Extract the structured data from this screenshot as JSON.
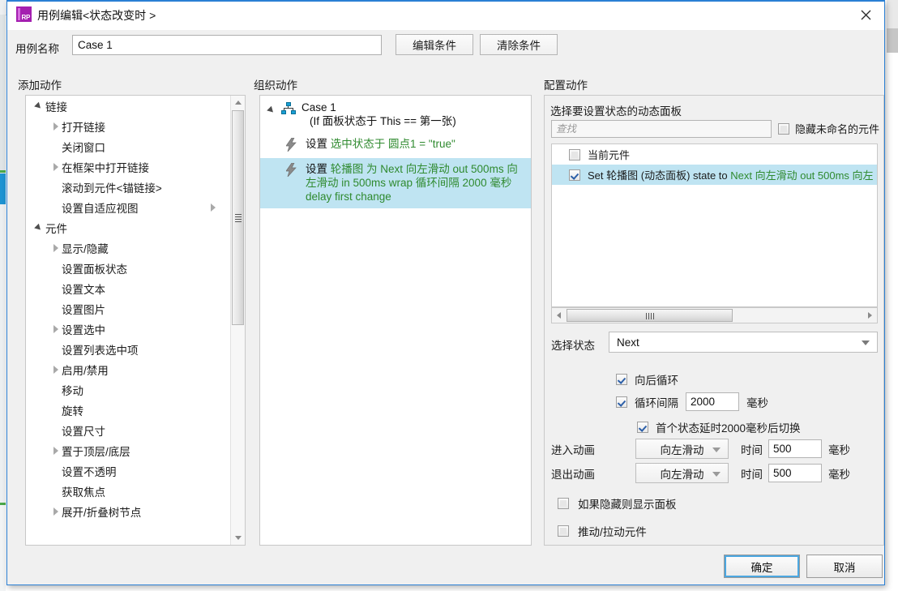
{
  "window": {
    "title": "用例编辑<状态改变时 >",
    "app_icon": "rp-logo-icon",
    "close_icon": "close-icon"
  },
  "name_row": {
    "label": "用例名称",
    "case_name_value": "Case 1",
    "edit_condition_label": "编辑条件",
    "clear_condition_label": "清除条件"
  },
  "columns": {
    "add_action": "添加动作",
    "organize_action": "组织动作",
    "configure_action": "配置动作"
  },
  "add_action_tree": [
    {
      "label": "链接",
      "level": 0,
      "caret": "open"
    },
    {
      "label": "打开链接",
      "level": 1,
      "caret": "closed"
    },
    {
      "label": "关闭窗口",
      "level": 1,
      "caret": "none"
    },
    {
      "label": "在框架中打开链接",
      "level": 1,
      "caret": "closed"
    },
    {
      "label": "滚动到元件<锚链接>",
      "level": 1,
      "caret": "none"
    },
    {
      "label": "设置自适应视图",
      "level": 1,
      "caret": "none",
      "right_caret": true
    },
    {
      "label": "元件",
      "level": 0,
      "caret": "open"
    },
    {
      "label": "显示/隐藏",
      "level": 1,
      "caret": "closed"
    },
    {
      "label": "设置面板状态",
      "level": 1,
      "caret": "none"
    },
    {
      "label": "设置文本",
      "level": 1,
      "caret": "none"
    },
    {
      "label": "设置图片",
      "level": 1,
      "caret": "none"
    },
    {
      "label": "设置选中",
      "level": 1,
      "caret": "closed"
    },
    {
      "label": "设置列表选中项",
      "level": 1,
      "caret": "none"
    },
    {
      "label": "启用/禁用",
      "level": 1,
      "caret": "closed"
    },
    {
      "label": "移动",
      "level": 1,
      "caret": "none"
    },
    {
      "label": "旋转",
      "level": 1,
      "caret": "none"
    },
    {
      "label": "设置尺寸",
      "level": 1,
      "caret": "none"
    },
    {
      "label": "置于顶层/底层",
      "level": 1,
      "caret": "closed"
    },
    {
      "label": "设置不透明",
      "level": 1,
      "caret": "none"
    },
    {
      "label": "获取焦点",
      "level": 1,
      "caret": "none"
    },
    {
      "label": "展开/折叠树节点",
      "level": 1,
      "caret": "closed"
    }
  ],
  "organize": {
    "case_icon": "sitemap-icon",
    "case_title": "Case 1",
    "case_condition": "(If 面板状态于 This == 第一张)",
    "actions": [
      {
        "icon": "lightning-bolt-icon",
        "selected": false,
        "parts": [
          {
            "text": "设置 ",
            "green": false
          },
          {
            "text": "选中状态于 圆点1 = \"true\"",
            "green": true
          }
        ]
      },
      {
        "icon": "lightning-bolt-icon",
        "selected": true,
        "parts": [
          {
            "text": "设置 ",
            "green": false
          },
          {
            "text": "轮播图 为 Next 向左滑动 out 500ms 向左滑动 in 500ms wrap 循环间隔 2000 毫秒 delay first change",
            "green": true
          }
        ]
      }
    ]
  },
  "configure": {
    "panel_title": "选择要设置状态的动态面板",
    "search_placeholder": "查找",
    "search_value": "",
    "hide_unnamed_label": "隐藏未命名的元件",
    "hide_unnamed_checked": false,
    "widget_list": [
      {
        "checked": false,
        "selected": false,
        "parts": [
          {
            "text": "当前元件",
            "green": false
          }
        ]
      },
      {
        "checked": true,
        "selected": true,
        "parts": [
          {
            "text": "Set 轮播图 (动态面板) state to ",
            "green": false
          },
          {
            "text": "Next 向左滑动 out 500ms 向左",
            "green": true
          }
        ]
      }
    ],
    "select_state_label": "选择状态",
    "select_state_value": "Next",
    "backward_loop_label": "向后循环",
    "backward_loop_checked": true,
    "loop_interval_label": "循环间隔",
    "loop_interval_value": "2000",
    "loop_interval_unit": "毫秒",
    "loop_interval_checked": true,
    "first_delay_label": "首个状态延时2000毫秒后切换",
    "first_delay_checked": true,
    "enter_anim_label": "进入动画",
    "enter_anim_value": "向左滑动",
    "enter_time_label": "时间",
    "enter_time_value": "500",
    "enter_time_unit": "毫秒",
    "exit_anim_label": "退出动画",
    "exit_anim_value": "向左滑动",
    "exit_time_label": "时间",
    "exit_time_value": "500",
    "exit_time_unit": "毫秒",
    "show_panel_label": "如果隐藏则显示面板",
    "show_panel_checked": false,
    "push_pull_label": "推动/拉动元件",
    "push_pull_checked": false
  },
  "footer": {
    "ok_label": "确定",
    "cancel_label": "取消"
  },
  "colors": {
    "accent_blue": "#2a7fd4",
    "selection_blue": "#bfe4f2",
    "green_text": "#2f8a2f",
    "app_icon_purple": "#a41fb0"
  }
}
